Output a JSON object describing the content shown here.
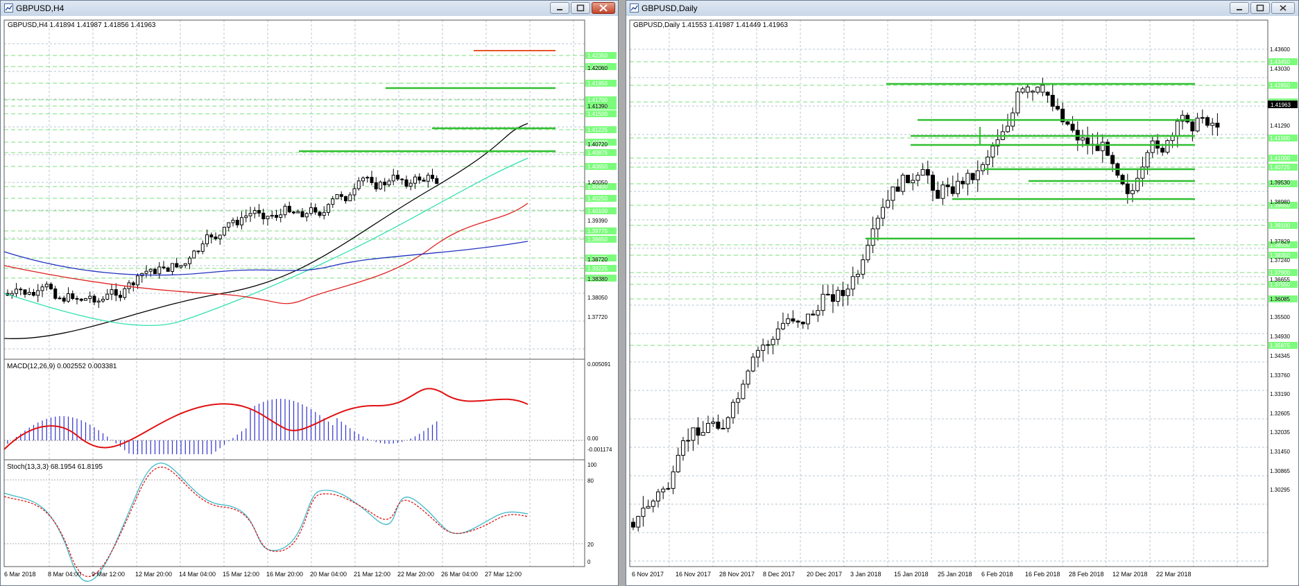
{
  "left_window": {
    "title": "GBPUSD,H4",
    "chart_header": "GBPUSD,H4  1.41894 1.41987 1.41856 1.41963",
    "price_axis_labels": [
      "1.42060",
      "1.41390",
      "1.40720",
      "1.40050",
      "1.39390",
      "1.38720",
      "1.38380",
      "1.38050",
      "1.37720"
    ],
    "level_tags": [
      "1.42350",
      "1.42175",
      "1.41950",
      "1.41700",
      "1.41625",
      "1.41500",
      "1.41225",
      "1.41000",
      "1.40875",
      "1.40650",
      "1.40400",
      "1.40250",
      "1.40100",
      "1.39775",
      "1.39650",
      "1.39375",
      "1.39225",
      "1.39100"
    ],
    "time_labels": [
      "6 Mar 2018",
      "8 Mar 04:00",
      "9 Mar 12:00",
      "12 Mar 20:00",
      "14 Mar 04:00",
      "15 Mar 12:00",
      "16 Mar 20:00",
      "20 Mar 04:00",
      "21 Mar 12:00",
      "22 Mar 20:00",
      "26 Mar 04:00",
      "27 Mar 12:00"
    ],
    "macd_header": "MACD(12,26,9) 0.002552 0.003381",
    "macd_axis": [
      "0.005091",
      "0.00",
      "-0.001174"
    ],
    "stoch_header": "Stoch(13,3,3) 68.1954 61.8195",
    "stoch_axis": [
      "100",
      "80",
      "20",
      "0"
    ]
  },
  "right_window": {
    "title": "GBPUSD,Daily",
    "chart_header": "GBPUSD,Daily  1.41553 1.41987 1.41449 1.41963",
    "price_axis_labels": [
      "1.43600",
      "1.43030",
      "1.41290",
      "1.39530",
      "1.38980",
      "1.37829",
      "1.37240",
      "1.36655",
      "1.36085",
      "1.35500",
      "1.34930",
      "1.34345",
      "1.33760",
      "1.33190",
      "1.32605",
      "1.32035",
      "1.31450",
      "1.30865",
      "1.30295"
    ],
    "current_price": "1.41963",
    "level_tags": [
      "1.43450",
      "1.42850",
      "1.42400",
      "1.41500",
      "1.41000",
      "1.40725",
      "1.40250",
      "1.39650",
      "1.39100",
      "1.38550",
      "1.38350",
      "1.37900",
      "1.37550",
      "1.37150",
      "1.35875"
    ],
    "time_labels": [
      "6 Nov 2017",
      "16 Nov 2017",
      "28 Nov 2017",
      "8 Dec 2017",
      "20 Dec 2017",
      "3 Jan 2018",
      "15 Jan 2018",
      "25 Jan 2018",
      "6 Feb 2018",
      "16 Feb 2018",
      "28 Feb 2018",
      "12 Mar 2018",
      "22 Mar 2018"
    ]
  },
  "colors": {
    "grid": "#B7C4D1",
    "level": "#2FBF2F",
    "level_tag_bg": "#7CFC7C",
    "resistance": "#E8542A",
    "ma_black": "#000000",
    "ma_cyan": "#33E0B0",
    "ma_red": "#E02020",
    "ma_blue": "#2030C0",
    "macd_hist": "#3030D0",
    "macd_signal": "#E01010",
    "stoch_main": "#3FB8C8",
    "stoch_signal": "#E01010"
  },
  "icons": [
    "chart-window-icon",
    "minimize-icon",
    "maximize-icon",
    "close-icon"
  ]
}
